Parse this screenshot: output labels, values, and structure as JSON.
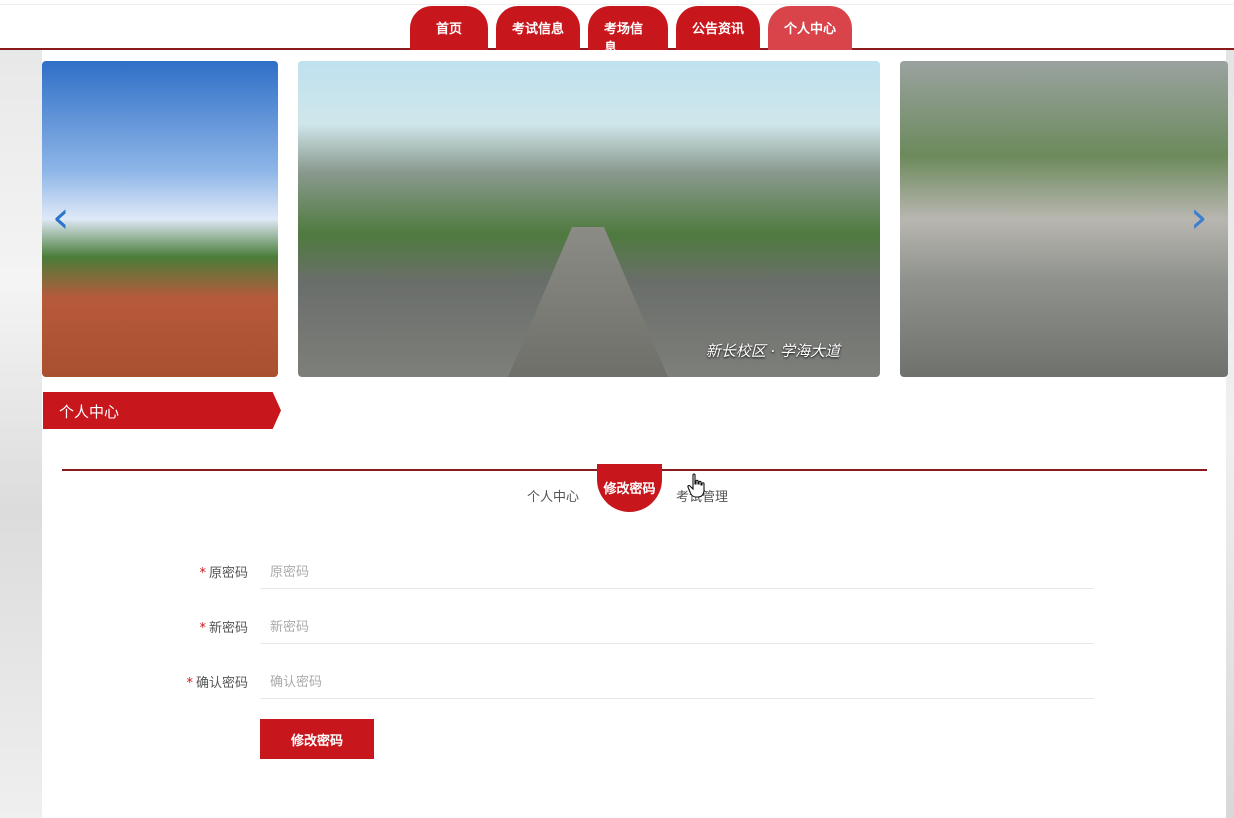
{
  "nav": {
    "items": [
      {
        "label": "首页"
      },
      {
        "label": "考试信息"
      },
      {
        "label": "考场信息"
      },
      {
        "label": "公告资讯"
      },
      {
        "label": "个人中心",
        "active": true
      }
    ]
  },
  "carousel": {
    "center_caption": "新长校区 · 学海大道",
    "prev_icon": "‹",
    "next_icon": "›"
  },
  "section": {
    "title": "个人中心"
  },
  "tabs": [
    {
      "label": "个人中心"
    },
    {
      "label": "修改密码",
      "active": true
    },
    {
      "label": "考试管理"
    }
  ],
  "form": {
    "fields": [
      {
        "label": "原密码",
        "placeholder": "原密码",
        "value": ""
      },
      {
        "label": "新密码",
        "placeholder": "新密码",
        "value": ""
      },
      {
        "label": "确认密码",
        "placeholder": "确认密码",
        "value": ""
      }
    ],
    "required_mark": "*",
    "submit_label": "修改密码"
  },
  "colors": {
    "brand_red": "#c8161d",
    "dark_red_line": "#8b1a1f",
    "active_tab_pink": "#d9434a"
  }
}
